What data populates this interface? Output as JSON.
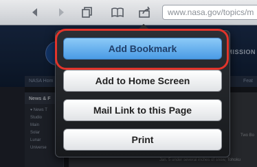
{
  "browser": {
    "url": "www.nasa.gov/topics/m",
    "icons": {
      "back": "back-arrow-icon",
      "forward": "forward-arrow-icon",
      "pages": "pages-icon",
      "bookmarks": "bookmarks-icon",
      "share": "share-icon"
    }
  },
  "page": {
    "banner_text": "MISSION",
    "nav_left": "NASA Hom",
    "nav_right": "Feat",
    "sidebar_heading": "News & F",
    "sidebar_items": [
      "▾ News T",
      "Studio",
      "Main",
      "Solar",
      "Lunar",
      "Universe"
    ],
    "side_text": "Two Bo",
    "caption": "Jan. 5 under several inches of snow, Tohoku"
  },
  "popover": {
    "items": [
      {
        "label": "Add Bookmark",
        "highlighted": true
      },
      {
        "label": "Add to Home Screen"
      },
      {
        "label": "Mail Link to this Page"
      },
      {
        "label": "Print"
      }
    ],
    "highlight_color": "#e2342b",
    "primary_color": "#4a9be5"
  }
}
